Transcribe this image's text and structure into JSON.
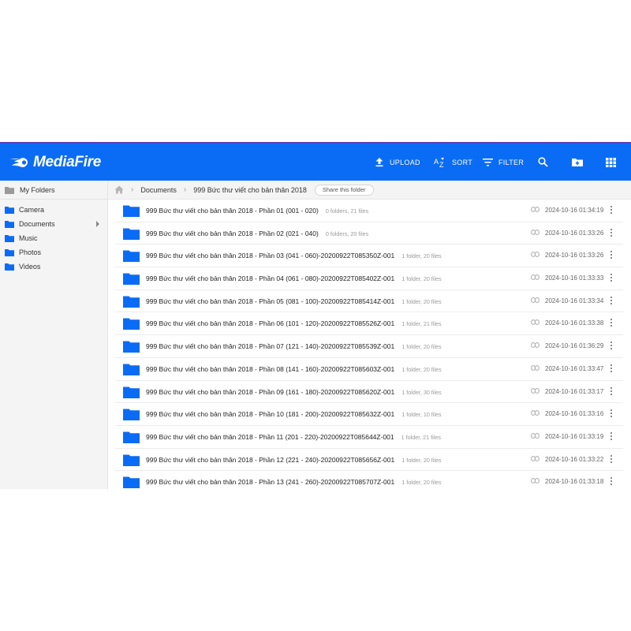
{
  "app": {
    "brand": "MediaFire",
    "accent": "#0a6cf5"
  },
  "toolbar": {
    "upload_label": "UPLOAD",
    "sort_label": "SORT",
    "filter_label": "FILTER"
  },
  "sidebar": {
    "header": "My Folders",
    "items": [
      {
        "label": "Camera"
      },
      {
        "label": "Documents"
      },
      {
        "label": "Music"
      },
      {
        "label": "Photos"
      },
      {
        "label": "Videos"
      }
    ]
  },
  "breadcrumb": {
    "level1": "Documents",
    "level2": "999 Bức thư viết cho bản thân 2018",
    "share_label": "Share this folder"
  },
  "rows": [
    {
      "name": "999 Bức thư viết cho bản thân 2018 - Phần 01 (001 - 020)",
      "meta": "0 folders, 21 files",
      "date": "2024-10-16 01:34:19"
    },
    {
      "name": "999 Bức thư viết cho bản thân 2018 - Phần 02 (021 - 040)",
      "meta": "0 folders, 20 files",
      "date": "2024-10-16 01:33:26"
    },
    {
      "name": "999 Bức thư viết cho bản thân 2018 - Phần 03 (041 - 060)-20200922T085350Z-001",
      "meta": "1 folder, 20 files",
      "date": "2024-10-16 01:33:26"
    },
    {
      "name": "999 Bức thư viết cho bản thân 2018 - Phần 04 (061 - 080)-20200922T085402Z-001",
      "meta": "1 folder, 20 files",
      "date": "2024-10-16 01:33:33"
    },
    {
      "name": "999 Bức thư viết cho bản thân 2018 - Phần 05 (081 - 100)-20200922T085414Z-001",
      "meta": "1 folder, 20 files",
      "date": "2024-10-16 01:33:34"
    },
    {
      "name": "999 Bức thư viết cho bản thân 2018 - Phần 06 (101 - 120)-20200922T085526Z-001",
      "meta": "1 folder, 21 files",
      "date": "2024-10-16 01:33:38"
    },
    {
      "name": "999 Bức thư viết cho bản thân 2018 - Phần 07 (121 - 140)-20200922T085539Z-001",
      "meta": "1 folder, 20 files",
      "date": "2024-10-16 01:36:29"
    },
    {
      "name": "999 Bức thư viết cho bản thân 2018 - Phần 08 (141 - 160)-20200922T085603Z-001",
      "meta": "1 folder, 20 files",
      "date": "2024-10-16 01:33:47"
    },
    {
      "name": "999 Bức thư viết cho bản thân 2018 - Phần 09 (161 - 180)-20200922T085620Z-001",
      "meta": "1 folder, 30 files",
      "date": "2024-10-16 01:33:17"
    },
    {
      "name": "999 Bức thư viết cho bản thân 2018 - Phần 10 (181 - 200)-20200922T085632Z-001",
      "meta": "1 folder, 10 files",
      "date": "2024-10-16 01:33:16"
    },
    {
      "name": "999 Bức thư viết cho bản thân 2018 - Phần 11 (201 - 220)-20200922T085644Z-001",
      "meta": "1 folder, 21 files",
      "date": "2024-10-16 01:33:19"
    },
    {
      "name": "999 Bức thư viết cho bản thân 2018 - Phần 12 (221 - 240)-20200922T085656Z-001",
      "meta": "1 folder, 20 files",
      "date": "2024-10-16 01:33:22"
    },
    {
      "name": "999 Bức thư viết cho bản thân 2018 - Phần 13 (241 - 260)-20200922T085707Z-001",
      "meta": "1 folder, 20 files",
      "date": "2024-10-16 01:33:18"
    }
  ]
}
